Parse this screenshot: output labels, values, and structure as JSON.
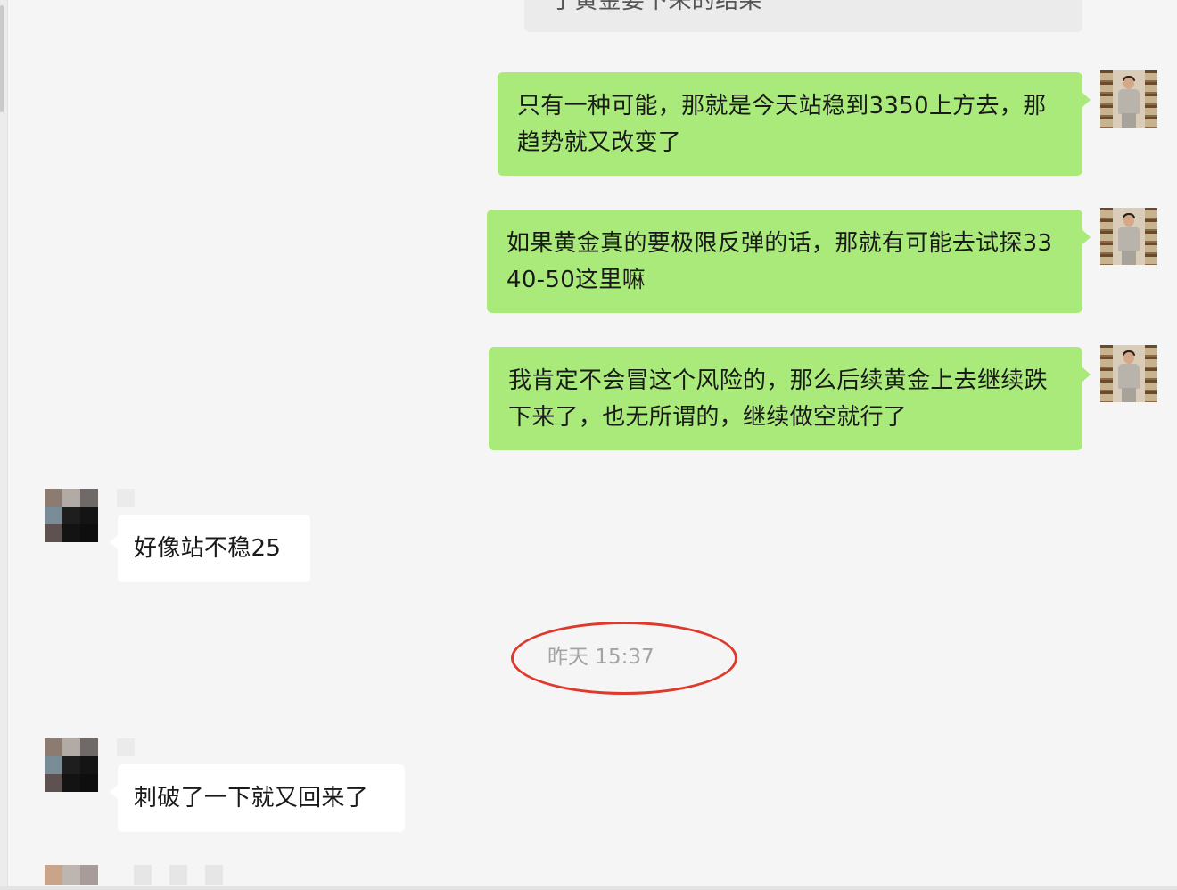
{
  "chat": {
    "top_partial_message": "了黄金要下来的结果",
    "messages_sent": [
      "只有一种可能，那就是今天站稳到3350上方去，那趋势就又改变了",
      "如果黄金真的要极限反弹的话，那就有可能去试探3340-50这里嘛",
      "我肯定不会冒这个风险的，那么后续黄金上去继续跌下来了，也无所谓的，继续做空就行了"
    ],
    "messages_received": [
      "好像站不稳25",
      "刺破了一下就又回来了"
    ],
    "timestamp": "昨天 15:37"
  },
  "colors": {
    "sent_bubble": "#a9ea7a",
    "received_bubble": "#ffffff",
    "background": "#f5f5f5",
    "annotation_circle": "#e0392b"
  },
  "icons": {
    "sender_avatar": "person-photo-avatar",
    "contact_avatar": "pixelated-avatar"
  }
}
